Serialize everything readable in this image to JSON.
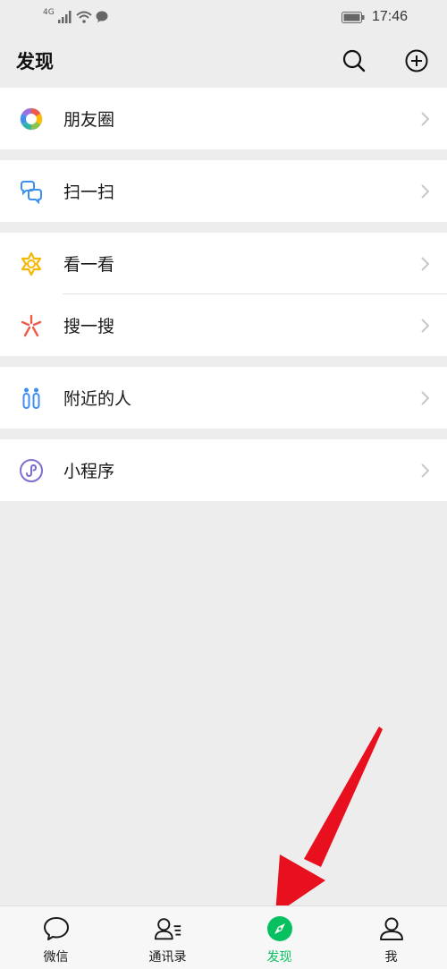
{
  "status_bar": {
    "network": "4G",
    "time": "17:46"
  },
  "header": {
    "title": "发现"
  },
  "menu": {
    "moments": "朋友圈",
    "scan": "扫一扫",
    "top_stories": "看一看",
    "search": "搜一搜",
    "people_nearby": "附近的人",
    "mini_programs": "小程序"
  },
  "tabbar": {
    "chats": "微信",
    "contacts": "通讯录",
    "discover": "发现",
    "me": "我"
  },
  "colors": {
    "accent": "#07c160",
    "annotation_arrow": "#e8101e",
    "background": "#ededed"
  },
  "icons": [
    "search-icon",
    "plus-circle-icon",
    "moments-icon",
    "scan-icon",
    "top-stories-icon",
    "search-sparkle-icon",
    "people-nearby-icon",
    "mini-program-icon",
    "chat-bubble-icon",
    "contacts-icon",
    "compass-icon",
    "person-icon"
  ]
}
